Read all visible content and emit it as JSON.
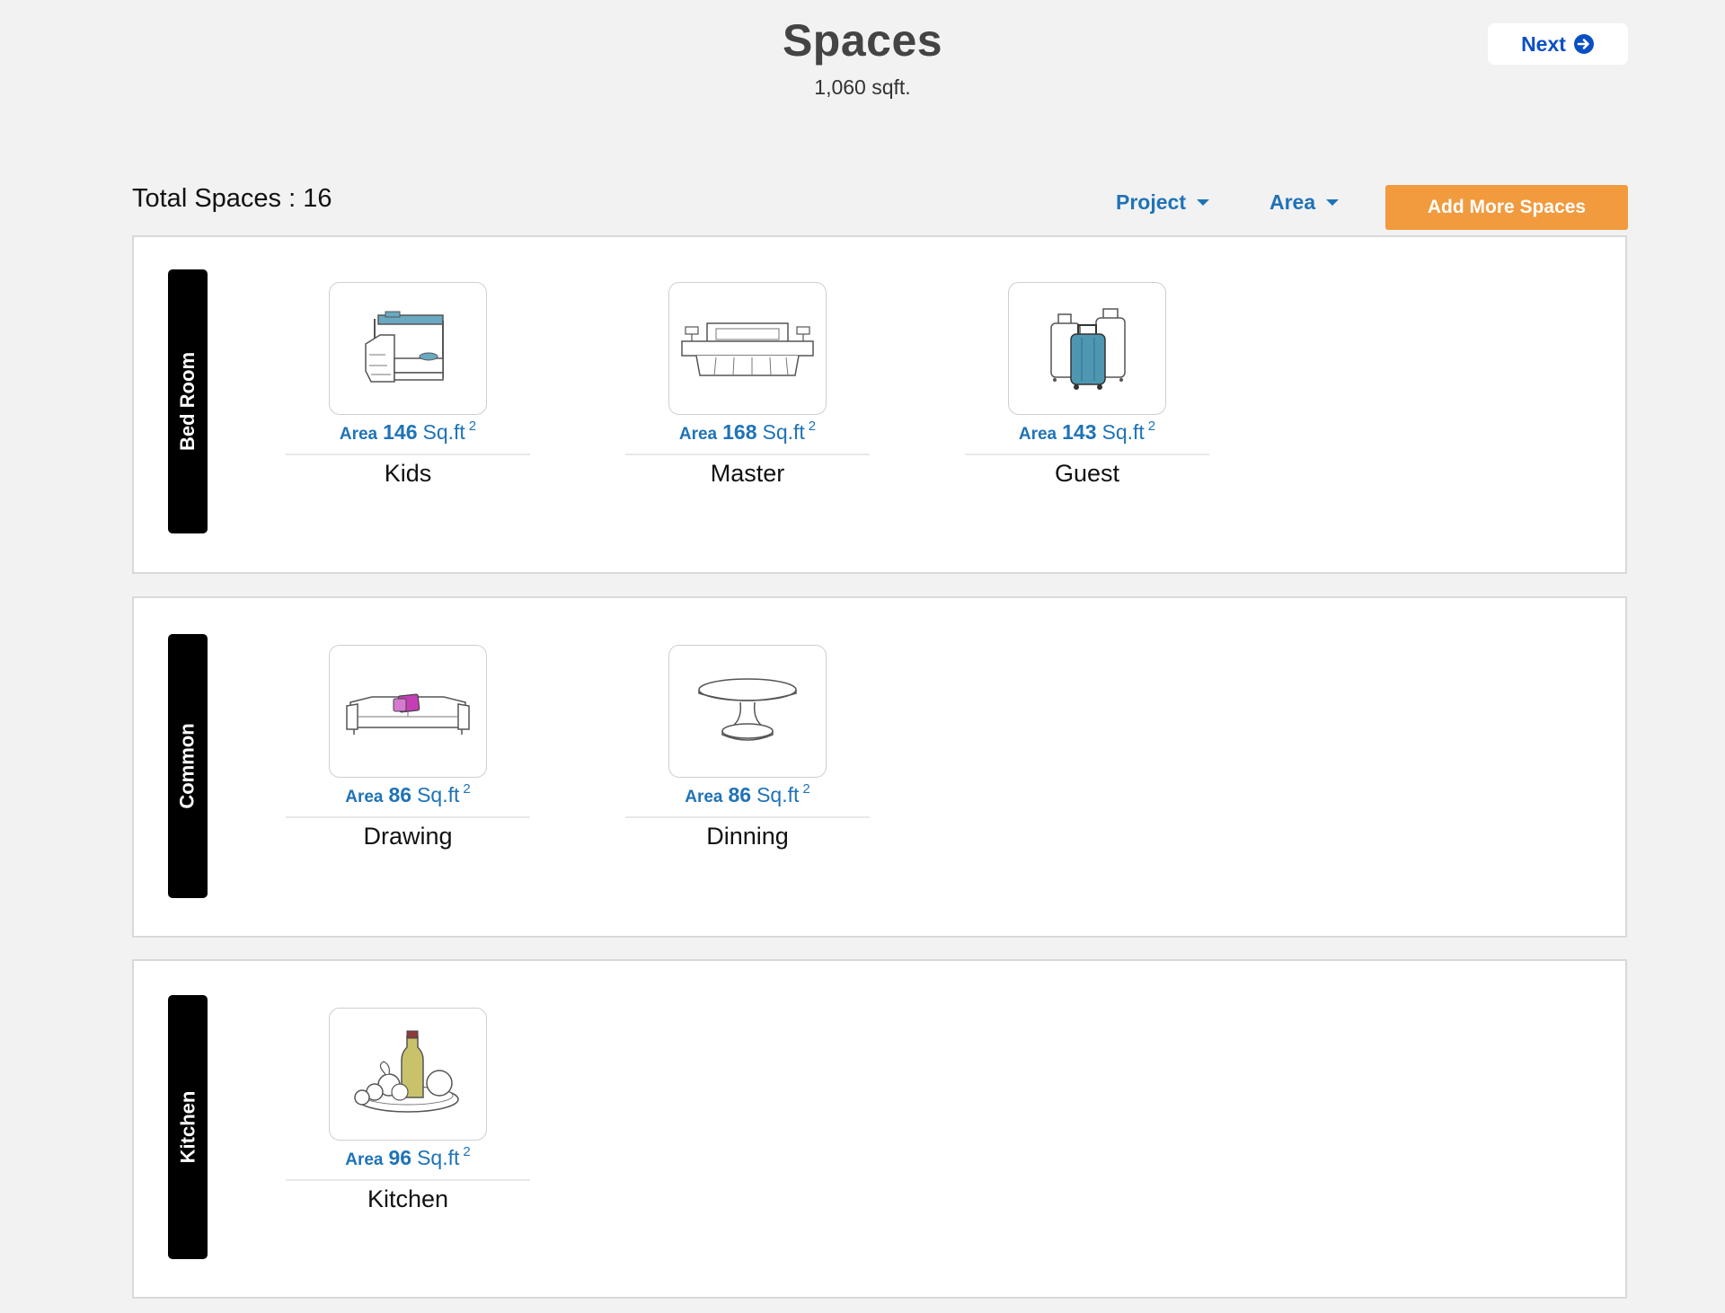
{
  "header": {
    "title": "Spaces",
    "subtitle": "1,060 sqft.",
    "next_label": "Next"
  },
  "toolbar": {
    "total_spaces": "Total Spaces : 16",
    "project_filter": "Project",
    "area_filter": "Area",
    "add_label": "Add More Spaces"
  },
  "colors": {
    "accent_blue": "#1f73b7",
    "next_blue": "#0b4fc4",
    "add_orange": "#f19a3e",
    "label_black": "#000000"
  },
  "sections": [
    {
      "label": "Bed Room",
      "rooms": [
        {
          "icon": "bunk-bed-icon",
          "area_label": "Area",
          "area": "146",
          "unit": "Sq.ft",
          "sup": "2",
          "name": "Kids"
        },
        {
          "icon": "double-bed-icon",
          "area_label": "Area",
          "area": "168",
          "unit": "Sq.ft",
          "sup": "2",
          "name": "Master"
        },
        {
          "icon": "luggage-icon",
          "area_label": "Area",
          "area": "143",
          "unit": "Sq.ft",
          "sup": "2",
          "name": "Guest"
        }
      ]
    },
    {
      "label": "Common",
      "rooms": [
        {
          "icon": "sofa-icon",
          "area_label": "Area",
          "area": "86",
          "unit": "Sq.ft",
          "sup": "2",
          "name": "Drawing"
        },
        {
          "icon": "round-table-icon",
          "area_label": "Area",
          "area": "86",
          "unit": "Sq.ft",
          "sup": "2",
          "name": "Dinning"
        }
      ]
    },
    {
      "label": "Kitchen",
      "rooms": [
        {
          "icon": "food-platter-icon",
          "area_label": "Area",
          "area": "96",
          "unit": "Sq.ft",
          "sup": "2",
          "name": "Kitchen"
        }
      ]
    }
  ]
}
